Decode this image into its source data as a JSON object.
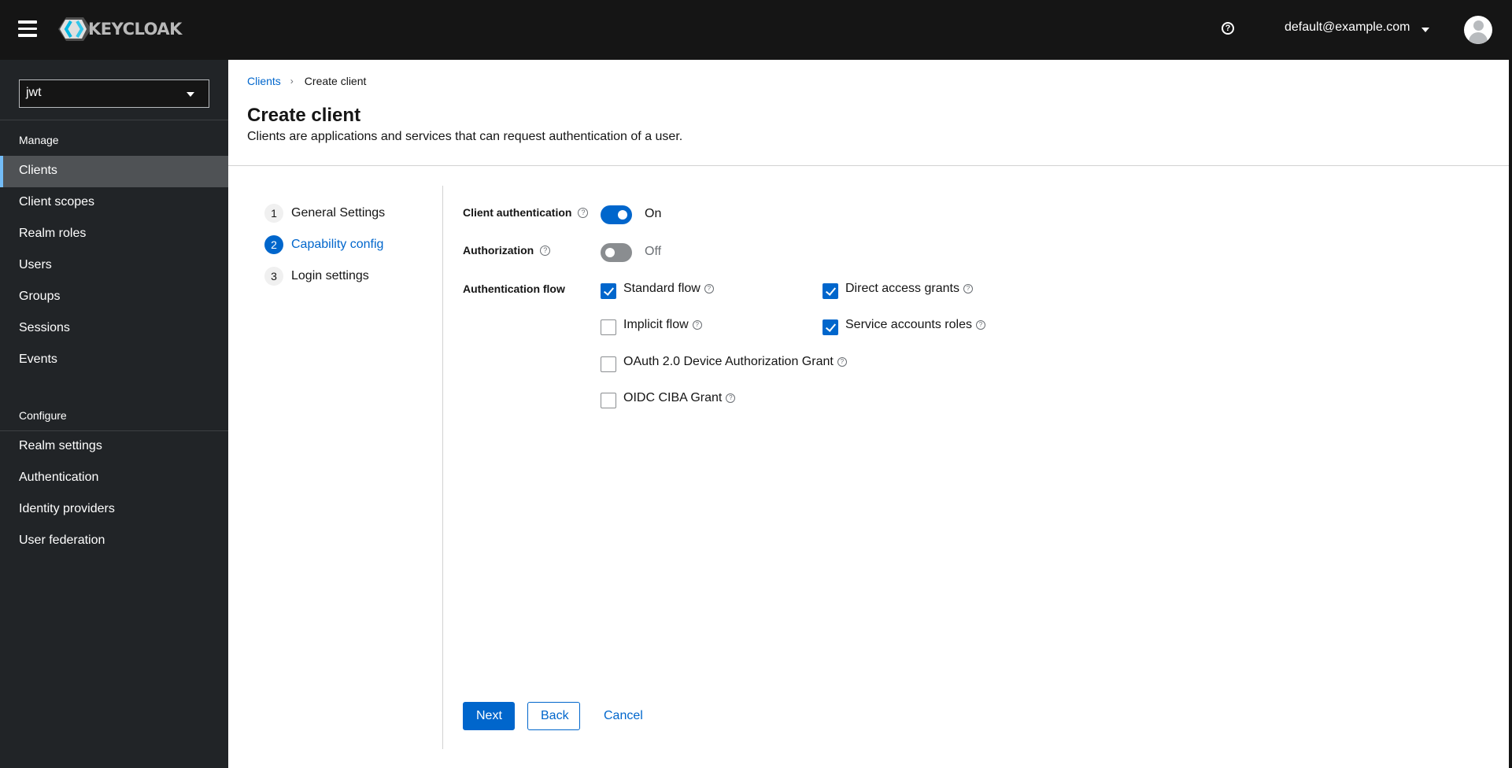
{
  "masthead": {
    "brand": "KEYCLOAK",
    "user": "default@example.com",
    "icons": {
      "menu": "hamburger-icon",
      "help": "help-icon",
      "user_menu": "caret-down-icon",
      "avatar": "user-avatar-icon"
    }
  },
  "sidebar": {
    "realm": "jwt",
    "sections": [
      {
        "title": "Manage",
        "items": [
          "Clients",
          "Client scopes",
          "Realm roles",
          "Users",
          "Groups",
          "Sessions",
          "Events"
        ]
      },
      {
        "title": "Configure",
        "items": [
          "Realm settings",
          "Authentication",
          "Identity providers",
          "User federation"
        ]
      }
    ],
    "active_item": "Clients"
  },
  "breadcrumb": {
    "items": [
      "Clients",
      "Create client"
    ],
    "separator": "›"
  },
  "page": {
    "title": "Create client",
    "description": "Clients are applications and services that can request authentication of a user."
  },
  "wizard": {
    "steps": [
      {
        "num": "1",
        "label": "General Settings"
      },
      {
        "num": "2",
        "label": "Capability config"
      },
      {
        "num": "3",
        "label": "Login settings"
      }
    ],
    "active_step": 2
  },
  "form": {
    "client_authentication": {
      "label": "Client authentication",
      "value": true,
      "state_text": "On"
    },
    "authorization": {
      "label": "Authorization",
      "value": false,
      "state_text": "Off"
    },
    "authentication_flow": {
      "label": "Authentication flow",
      "options": [
        {
          "label": "Standard flow",
          "checked": true
        },
        {
          "label": "Direct access grants",
          "checked": true
        },
        {
          "label": "Implicit flow",
          "checked": false
        },
        {
          "label": "Service accounts roles",
          "checked": true
        },
        {
          "label": "OAuth 2.0 Device Authorization Grant",
          "checked": false
        },
        {
          "label": "OIDC CIBA Grant",
          "checked": false
        }
      ]
    },
    "help_glyph": "?"
  },
  "actions": {
    "next": "Next",
    "back": "Back",
    "cancel": "Cancel"
  },
  "colors": {
    "primary": "#0066cc",
    "masthead": "#151515",
    "sidebar": "#212427",
    "sidebar_active": "#4f5255",
    "sidebar_active_accent": "#73bcf7"
  }
}
